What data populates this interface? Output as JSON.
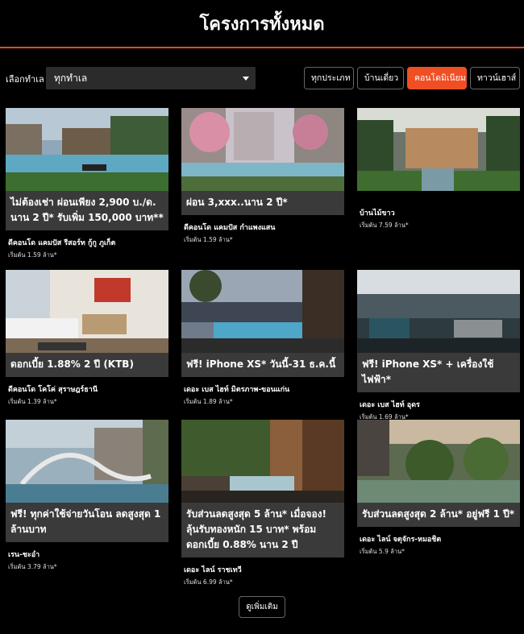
{
  "header": {
    "title": "โครงการทั้งหมด"
  },
  "filter": {
    "location_label": "เลือกทำเล",
    "location_value": "ทุกทำเล",
    "tabs": [
      {
        "label": "ทุกประเภท",
        "active": false
      },
      {
        "label": "บ้านเดี่ยว",
        "active": false
      },
      {
        "label": "คอนโดมิเนียม",
        "active": true
      },
      {
        "label": "ทาวน์เฮาส์",
        "active": false
      }
    ]
  },
  "colors": {
    "accent": "#f04e23",
    "promo_bg": "#3a3a3a",
    "background": "#000000"
  },
  "cards": [
    {
      "promo": "ไม่ต้องเช่า ผ่อนเพียง 2,900 บ./ด. นาน 2 ปี* รับเพิ่ม 150,000 บาท**",
      "project": "ดีคอนโด แคมปัส รีสอร์ท กู้กู ภูเก็ต",
      "price": "เริ่มต้น 1.59 ล้าน*"
    },
    {
      "promo": "ผ่อน 3,xxx..นาน 2 ปี*",
      "project": "ดีคอนโด แคมปัส กำแพงแสน",
      "price": "เริ่มต้น 1.59 ล้าน*"
    },
    {
      "promo": "",
      "project": "บ้านไม้ขาว",
      "price": "เริ่มต้น 7.59 ล้าน*"
    },
    {
      "promo": "ดอกเบี้ย 1.88% 2 ปี (KTB)",
      "project": "ดีคอนโด โคโค่ สุราษฎร์ธานี",
      "price": "เริ่มต้น 1.39 ล้าน*"
    },
    {
      "promo": "ฟรี! iPhone XS* วันนี้-31 ธ.ค.นี้",
      "project": "เดอะ เบส ไฮท์ มิตรภาพ-ขอนแก่น",
      "price": "เริ่มต้น 1.89 ล้าน*"
    },
    {
      "promo": "ฟรี! iPhone XS* + เครื่องใช้ไฟฟ้า*",
      "project": "เดอะ เบส ไฮท์ อุดร",
      "price": "เริ่มต้น 1.69 ล้าน*"
    },
    {
      "promo": "ฟรี! ทุกค่าใช้จ่ายวันโอน ลดสูงสุด 1 ล้านบาท",
      "project": "เรน-ชะอำ",
      "price": "เริ่มต้น 3.79 ล้าน*"
    },
    {
      "promo": "รับส่วนลดสูงสุด 5 ล้าน* เมื่อจอง! ลุ้นรับทองหนัก 15 บาท* พร้อม ดอกเบี้ย 0.88% นาน 2 ปี",
      "project": "เดอะ ไลน์ ราชเทวี",
      "price": "เริ่มต้น 6.99 ล้าน*"
    },
    {
      "promo": "รับส่วนลดสูงสุด 2 ล้าน* อยู่ฟรี 1 ปี*",
      "project": "เดอะ ไลน์ จตุจักร-หมอชิต",
      "price": "เริ่มต้น 5.9 ล้าน*"
    }
  ],
  "footer": {
    "more_label": "ดูเพิ่มเติม"
  }
}
